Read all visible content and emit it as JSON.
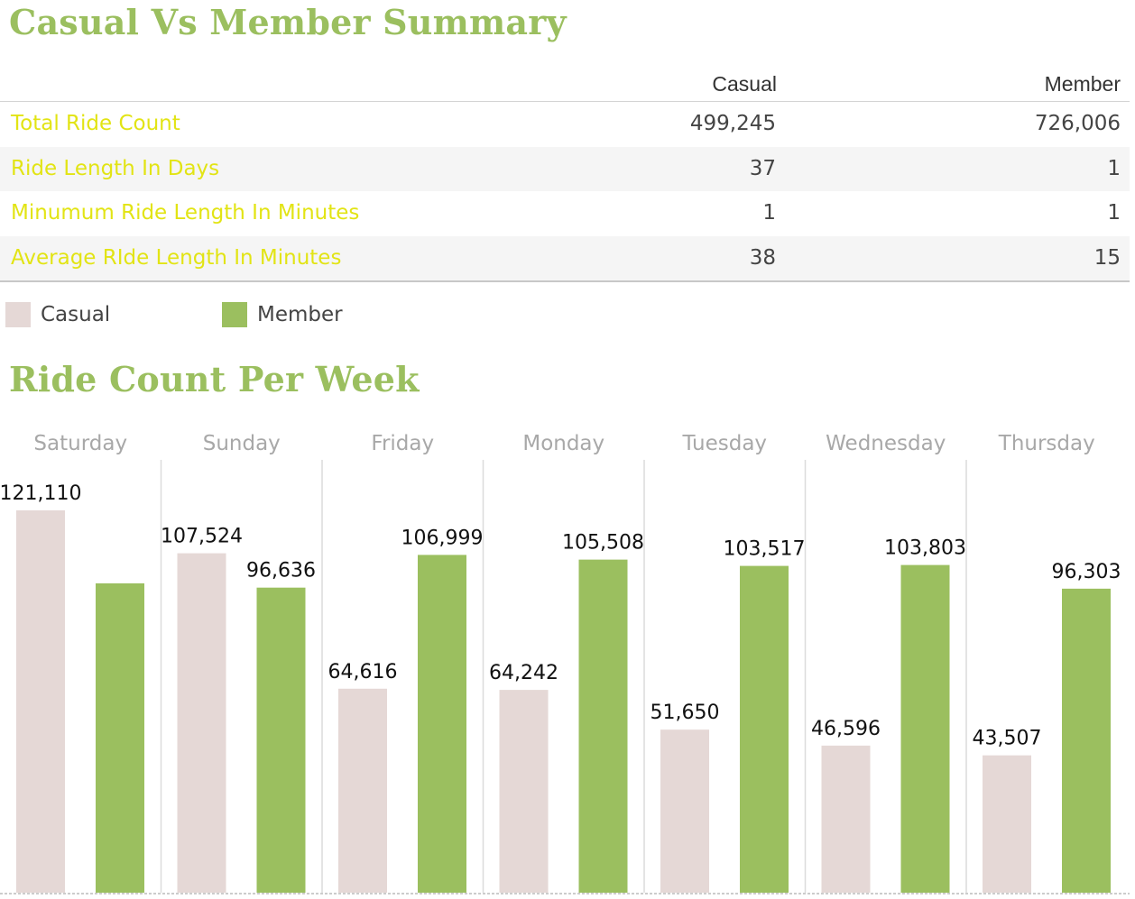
{
  "summary": {
    "title": "Casual Vs Member Summary",
    "columns": [
      "Casual",
      "Member"
    ],
    "rows": [
      {
        "label": "Total Ride Count",
        "casual": "499,245",
        "member": "726,006"
      },
      {
        "label": "Ride Length In Days",
        "casual": "37",
        "member": "1"
      },
      {
        "label": "Minumum Ride Length In Minutes",
        "casual": "1",
        "member": "1"
      },
      {
        "label": "Average RIde Length In Minutes",
        "casual": "38",
        "member": "15"
      }
    ]
  },
  "legend": {
    "items": [
      {
        "label": "Casual",
        "color": "#e5d8d6"
      },
      {
        "label": "Member",
        "color": "#9bbf5f"
      }
    ]
  },
  "chart_title": "Ride Count Per Week",
  "chart_data": {
    "type": "bar",
    "title": "Ride Count Per Week",
    "categories": [
      "Saturday",
      "Sunday",
      "Friday",
      "Monday",
      "Tuesday",
      "Wednesday",
      "Thursday"
    ],
    "series": [
      {
        "name": "Casual",
        "color": "#e5d8d6",
        "values": [
          121110,
          107524,
          64616,
          64242,
          51650,
          46596,
          43507
        ]
      },
      {
        "name": "Member",
        "color": "#9bbf5f",
        "values": [
          98000,
          96636,
          106999,
          105508,
          103517,
          103803,
          96303
        ]
      }
    ],
    "data_labels": [
      [
        "121,110",
        "107,524",
        "64,616",
        "64,242",
        "51,650",
        "46,596",
        "43,507"
      ],
      [
        "",
        "96,636",
        "106,999",
        "105,508",
        "103,517",
        "103,803",
        "96,303"
      ]
    ],
    "ylim": [
      0,
      121110
    ],
    "grid": false,
    "legend_position": "top-left"
  }
}
